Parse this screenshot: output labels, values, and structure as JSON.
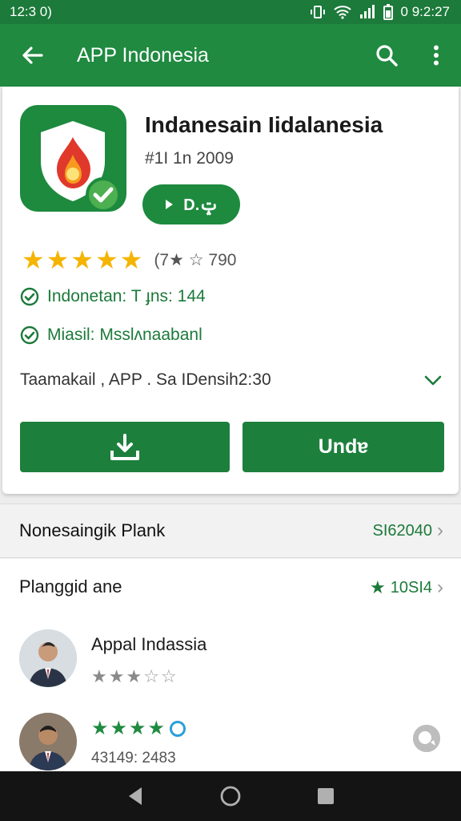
{
  "status": {
    "time": "12:3 0)",
    "right_time": "0 9:2:27"
  },
  "appbar": {
    "title": "APP Indonesia",
    "back_icon": "back-arrow-icon",
    "search_icon": "search-icon",
    "menu_icon": "more-vert-icon"
  },
  "app": {
    "name": "Indanesain Iidalanesia",
    "subtitle": "#1I 1n 2009",
    "open_label": "D.ݓ",
    "rating_text": "(7★ ☆ 790",
    "rating_stars": 5,
    "info1": "Indonetan: T ɟns: 144",
    "info2": "Miasil: Msslʌnaabanl",
    "developer_line": "Taamakail , APP .  Sa IDensih2:30",
    "install_label": "Undɐ"
  },
  "sections": {
    "similar": {
      "title": "Nonesaingik Plank",
      "value": "SI62040"
    },
    "reviews": {
      "title": "Planggid ane",
      "value": "10SI4"
    }
  },
  "reviews": [
    {
      "name": "Appal Indassia",
      "stars": 3,
      "meta": ""
    },
    {
      "name": "",
      "stars": 4,
      "meta": "43149: 2483"
    }
  ],
  "colors": {
    "primary": "#1f8a40",
    "status": "#1c7a3a",
    "star": "#f5b400"
  }
}
